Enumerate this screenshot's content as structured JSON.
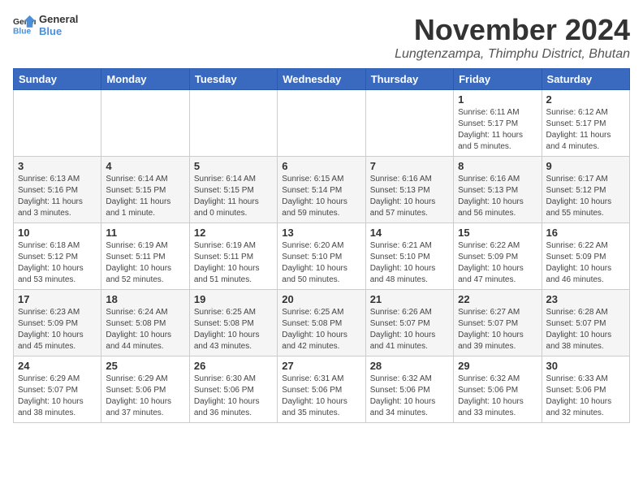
{
  "logo": {
    "text_general": "General",
    "text_blue": "Blue"
  },
  "header": {
    "title": "November 2024",
    "subtitle": "Lungtenzampa, Thimphu District, Bhutan"
  },
  "weekdays": [
    "Sunday",
    "Monday",
    "Tuesday",
    "Wednesday",
    "Thursday",
    "Friday",
    "Saturday"
  ],
  "weeks": [
    [
      {
        "day": "",
        "info": ""
      },
      {
        "day": "",
        "info": ""
      },
      {
        "day": "",
        "info": ""
      },
      {
        "day": "",
        "info": ""
      },
      {
        "day": "",
        "info": ""
      },
      {
        "day": "1",
        "info": "Sunrise: 6:11 AM\nSunset: 5:17 PM\nDaylight: 11 hours\nand 5 minutes."
      },
      {
        "day": "2",
        "info": "Sunrise: 6:12 AM\nSunset: 5:17 PM\nDaylight: 11 hours\nand 4 minutes."
      }
    ],
    [
      {
        "day": "3",
        "info": "Sunrise: 6:13 AM\nSunset: 5:16 PM\nDaylight: 11 hours\nand 3 minutes."
      },
      {
        "day": "4",
        "info": "Sunrise: 6:14 AM\nSunset: 5:15 PM\nDaylight: 11 hours\nand 1 minute."
      },
      {
        "day": "5",
        "info": "Sunrise: 6:14 AM\nSunset: 5:15 PM\nDaylight: 11 hours\nand 0 minutes."
      },
      {
        "day": "6",
        "info": "Sunrise: 6:15 AM\nSunset: 5:14 PM\nDaylight: 10 hours\nand 59 minutes."
      },
      {
        "day": "7",
        "info": "Sunrise: 6:16 AM\nSunset: 5:13 PM\nDaylight: 10 hours\nand 57 minutes."
      },
      {
        "day": "8",
        "info": "Sunrise: 6:16 AM\nSunset: 5:13 PM\nDaylight: 10 hours\nand 56 minutes."
      },
      {
        "day": "9",
        "info": "Sunrise: 6:17 AM\nSunset: 5:12 PM\nDaylight: 10 hours\nand 55 minutes."
      }
    ],
    [
      {
        "day": "10",
        "info": "Sunrise: 6:18 AM\nSunset: 5:12 PM\nDaylight: 10 hours\nand 53 minutes."
      },
      {
        "day": "11",
        "info": "Sunrise: 6:19 AM\nSunset: 5:11 PM\nDaylight: 10 hours\nand 52 minutes."
      },
      {
        "day": "12",
        "info": "Sunrise: 6:19 AM\nSunset: 5:11 PM\nDaylight: 10 hours\nand 51 minutes."
      },
      {
        "day": "13",
        "info": "Sunrise: 6:20 AM\nSunset: 5:10 PM\nDaylight: 10 hours\nand 50 minutes."
      },
      {
        "day": "14",
        "info": "Sunrise: 6:21 AM\nSunset: 5:10 PM\nDaylight: 10 hours\nand 48 minutes."
      },
      {
        "day": "15",
        "info": "Sunrise: 6:22 AM\nSunset: 5:09 PM\nDaylight: 10 hours\nand 47 minutes."
      },
      {
        "day": "16",
        "info": "Sunrise: 6:22 AM\nSunset: 5:09 PM\nDaylight: 10 hours\nand 46 minutes."
      }
    ],
    [
      {
        "day": "17",
        "info": "Sunrise: 6:23 AM\nSunset: 5:09 PM\nDaylight: 10 hours\nand 45 minutes."
      },
      {
        "day": "18",
        "info": "Sunrise: 6:24 AM\nSunset: 5:08 PM\nDaylight: 10 hours\nand 44 minutes."
      },
      {
        "day": "19",
        "info": "Sunrise: 6:25 AM\nSunset: 5:08 PM\nDaylight: 10 hours\nand 43 minutes."
      },
      {
        "day": "20",
        "info": "Sunrise: 6:25 AM\nSunset: 5:08 PM\nDaylight: 10 hours\nand 42 minutes."
      },
      {
        "day": "21",
        "info": "Sunrise: 6:26 AM\nSunset: 5:07 PM\nDaylight: 10 hours\nand 41 minutes."
      },
      {
        "day": "22",
        "info": "Sunrise: 6:27 AM\nSunset: 5:07 PM\nDaylight: 10 hours\nand 39 minutes."
      },
      {
        "day": "23",
        "info": "Sunrise: 6:28 AM\nSunset: 5:07 PM\nDaylight: 10 hours\nand 38 minutes."
      }
    ],
    [
      {
        "day": "24",
        "info": "Sunrise: 6:29 AM\nSunset: 5:07 PM\nDaylight: 10 hours\nand 38 minutes."
      },
      {
        "day": "25",
        "info": "Sunrise: 6:29 AM\nSunset: 5:06 PM\nDaylight: 10 hours\nand 37 minutes."
      },
      {
        "day": "26",
        "info": "Sunrise: 6:30 AM\nSunset: 5:06 PM\nDaylight: 10 hours\nand 36 minutes."
      },
      {
        "day": "27",
        "info": "Sunrise: 6:31 AM\nSunset: 5:06 PM\nDaylight: 10 hours\nand 35 minutes."
      },
      {
        "day": "28",
        "info": "Sunrise: 6:32 AM\nSunset: 5:06 PM\nDaylight: 10 hours\nand 34 minutes."
      },
      {
        "day": "29",
        "info": "Sunrise: 6:32 AM\nSunset: 5:06 PM\nDaylight: 10 hours\nand 33 minutes."
      },
      {
        "day": "30",
        "info": "Sunrise: 6:33 AM\nSunset: 5:06 PM\nDaylight: 10 hours\nand 32 minutes."
      }
    ]
  ]
}
